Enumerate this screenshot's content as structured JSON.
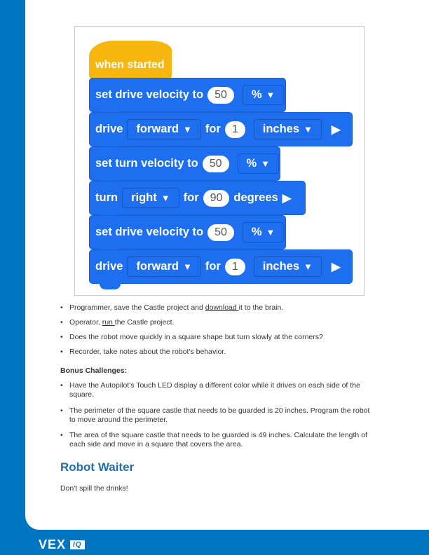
{
  "blocks": {
    "hat": "when started",
    "b1": {
      "text": "set drive velocity to",
      "value": "50",
      "unit": "%"
    },
    "b2": {
      "cmd": "drive",
      "dir": "forward",
      "for": "for",
      "value": "1",
      "unit": "inches"
    },
    "b3": {
      "text": "set turn velocity to",
      "value": "50",
      "unit": "%"
    },
    "b4": {
      "cmd": "turn",
      "dir": "right",
      "for": "for",
      "value": "90",
      "unit": "degrees"
    },
    "b5": {
      "text": "set drive velocity to",
      "value": "50",
      "unit": "%"
    },
    "b6": {
      "cmd": "drive",
      "dir": "forward",
      "for": "for",
      "value": "1",
      "unit": "inches"
    }
  },
  "bullets": [
    {
      "pre": "Programmer, save the Castle project and ",
      "link": "download ",
      "post": "it to the brain."
    },
    {
      "pre": "Operator, ",
      "link": "run ",
      "post": "the Castle project."
    },
    {
      "pre": "Does the robot move quickly in a square shape but turn slowly at the corners?",
      "link": "",
      "post": ""
    },
    {
      "pre": "Recorder, take notes about the robot's behavior.",
      "link": "",
      "post": ""
    }
  ],
  "bonus_title": "Bonus Challenges:",
  "bonus": [
    "Have the Autopilot's Touch LED display a different color while it drives on each side of the square.",
    "The perimeter of the square castle that needs to be guarded is 20 inches. Program the robot to move around the perimeter.",
    "The area of the square castle that needs to be guarded is 49 inches. Calculate the length of each side and move in a square that covers the area."
  ],
  "section_title": "Robot Waiter",
  "section_text": "Don't spill the drinks!",
  "logo": {
    "brand": "VEX",
    "sub": "IQ"
  }
}
